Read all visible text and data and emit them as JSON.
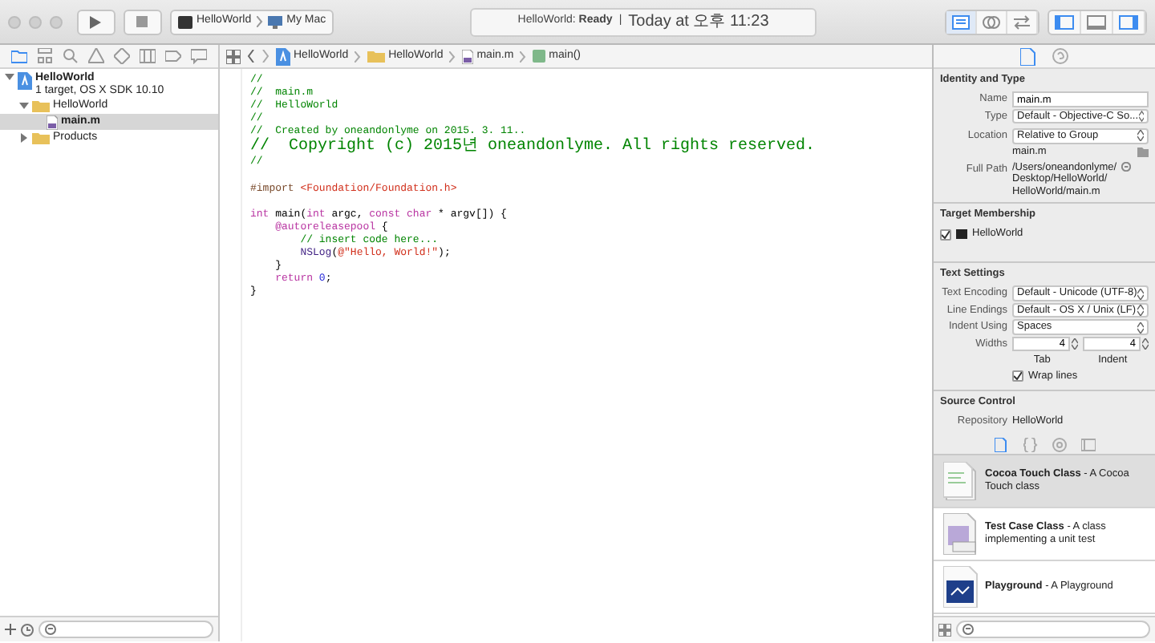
{
  "toolbar": {
    "scheme": "HelloWorld",
    "destination": "My Mac",
    "activity": {
      "project": "HelloWorld:",
      "status": "Ready",
      "separator": "|",
      "time": "Today at 오후 11:23"
    },
    "editor_modes": [
      {
        "kind": "standard",
        "selected": true
      },
      {
        "kind": "assistant",
        "selected": false
      },
      {
        "kind": "version",
        "selected": false
      }
    ],
    "view_toggles": [
      {
        "kind": "navigator",
        "on": true
      },
      {
        "kind": "debug",
        "on": false
      },
      {
        "kind": "utilities",
        "on": true
      }
    ]
  },
  "navigator": {
    "tabs": [
      {
        "kind": "project",
        "selected": true
      },
      {
        "kind": "symbol",
        "selected": false
      },
      {
        "kind": "find",
        "selected": false
      },
      {
        "kind": "issue",
        "selected": false
      },
      {
        "kind": "test",
        "selected": false
      },
      {
        "kind": "debug",
        "selected": false
      },
      {
        "kind": "breakpoint",
        "selected": false
      },
      {
        "kind": "report",
        "selected": false
      }
    ],
    "tree": [
      {
        "kind": "project",
        "label": "HelloWorld",
        "subtitle": "1 target, OS X SDK 10.10",
        "expanded": true,
        "selected": false,
        "children": [
          {
            "kind": "group",
            "label": "HelloWorld",
            "expanded": true,
            "selected": false,
            "children": [
              {
                "kind": "file",
                "label": "main.m",
                "selected": true
              }
            ]
          },
          {
            "kind": "group",
            "label": "Products",
            "expanded": false,
            "selected": false
          }
        ]
      }
    ]
  },
  "jump_bar": [
    {
      "kind": "project",
      "label": "HelloWorld"
    },
    {
      "kind": "group",
      "label": "HelloWorld"
    },
    {
      "kind": "file",
      "label": "main.m"
    },
    {
      "kind": "function",
      "label": "main()"
    }
  ],
  "code": [
    {
      "tokens": [
        {
          "kind": "comment",
          "text": "//"
        }
      ]
    },
    {
      "tokens": [
        {
          "kind": "comment",
          "text": "//  main.m"
        }
      ]
    },
    {
      "tokens": [
        {
          "kind": "comment",
          "text": "//  HelloWorld"
        }
      ]
    },
    {
      "tokens": [
        {
          "kind": "comment",
          "text": "//"
        }
      ]
    },
    {
      "tokens": [
        {
          "kind": "comment",
          "text": "//  Created by oneandonlyme on 2015. 3. 11.."
        }
      ]
    },
    {
      "tokens": [
        {
          "kind": "comment",
          "text": "//  Copyright (c) 2015년 oneandonlyme. All rights reserved."
        }
      ]
    },
    {
      "tokens": [
        {
          "kind": "comment",
          "text": "//"
        }
      ]
    },
    {
      "kind": "blank"
    },
    {
      "tokens": [
        {
          "kind": "preprocessor",
          "text": "#import "
        },
        {
          "kind": "string",
          "text": "<Foundation/Foundation.h>"
        }
      ]
    },
    {
      "kind": "blank"
    },
    {
      "tokens": [
        {
          "kind": "keyword",
          "text": "int"
        },
        {
          "kind": "plain",
          "text": " main("
        },
        {
          "kind": "keyword",
          "text": "int"
        },
        {
          "kind": "plain",
          "text": " argc, "
        },
        {
          "kind": "keyword",
          "text": "const char"
        },
        {
          "kind": "plain",
          "text": " * argv[]) {"
        }
      ]
    },
    {
      "tokens": [
        {
          "kind": "keyword",
          "text": "    @autoreleasepool"
        },
        {
          "kind": "plain",
          "text": " {"
        }
      ]
    },
    {
      "tokens": [
        {
          "kind": "comment",
          "text": "        // insert code here..."
        }
      ]
    },
    {
      "tokens": [
        {
          "kind": "api",
          "text": "        NSLog"
        },
        {
          "kind": "plain",
          "text": "("
        },
        {
          "kind": "string",
          "text": "@\"Hello, World!\""
        },
        {
          "kind": "plain",
          "text": ");"
        }
      ]
    },
    {
      "tokens": [
        {
          "kind": "plain",
          "text": "    }"
        }
      ]
    },
    {
      "tokens": [
        {
          "kind": "keyword",
          "text": "    return"
        },
        {
          "kind": "number",
          "text": " 0"
        },
        {
          "kind": "plain",
          "text": ";"
        }
      ]
    },
    {
      "tokens": [
        {
          "kind": "plain",
          "text": "}"
        }
      ]
    }
  ],
  "inspector": {
    "tabs": [
      {
        "kind": "file",
        "selected": true
      },
      {
        "kind": "help",
        "selected": false
      }
    ],
    "identity": {
      "title": "Identity and Type",
      "name": {
        "label": "Name",
        "value": "main.m"
      },
      "type": {
        "label": "Type",
        "value": "Default - Objective-C So..."
      },
      "location": {
        "label": "Location",
        "value": "Relative to Group"
      },
      "relative_path": "main.m",
      "full_path": {
        "label": "Full Path",
        "lines": [
          "/Users/oneandonlyme/",
          "Desktop/HelloWorld/",
          "HelloWorld/main.m"
        ]
      }
    },
    "target_membership": {
      "title": "Target Membership",
      "targets": [
        {
          "label": "HelloWorld",
          "checked": true
        }
      ]
    },
    "text_settings": {
      "title": "Text Settings",
      "rows": [
        {
          "label": "Text Encoding",
          "value": "Default - Unicode (UTF-8)"
        },
        {
          "label": "Line Endings",
          "value": "Default - OS X / Unix (LF)"
        },
        {
          "label": "Indent Using",
          "value": "Spaces"
        }
      ],
      "widths": {
        "label": "Widths",
        "tab": {
          "value": "4",
          "label": "Tab"
        },
        "indent": {
          "value": "4",
          "label": "Indent"
        }
      },
      "wrap_lines": {
        "label": "Wrap lines",
        "checked": true
      }
    },
    "source_control": {
      "title": "Source Control",
      "repository": {
        "label": "Repository",
        "value": "HelloWorld"
      }
    }
  },
  "library": {
    "tabs": [
      {
        "kind": "file",
        "selected": true
      },
      {
        "kind": "code",
        "selected": false
      },
      {
        "kind": "object",
        "selected": false
      },
      {
        "kind": "media",
        "selected": false
      }
    ],
    "items": [
      {
        "kind": "cocoa",
        "text": "**Cocoa Touch Class** - A Cocoa Touch class",
        "selected": true
      },
      {
        "kind": "test",
        "text": "**Test Case Class** - A class implementing a unit test",
        "selected": false
      },
      {
        "kind": "playground",
        "text": "**Playground** - A Playground",
        "selected": false
      }
    ]
  }
}
